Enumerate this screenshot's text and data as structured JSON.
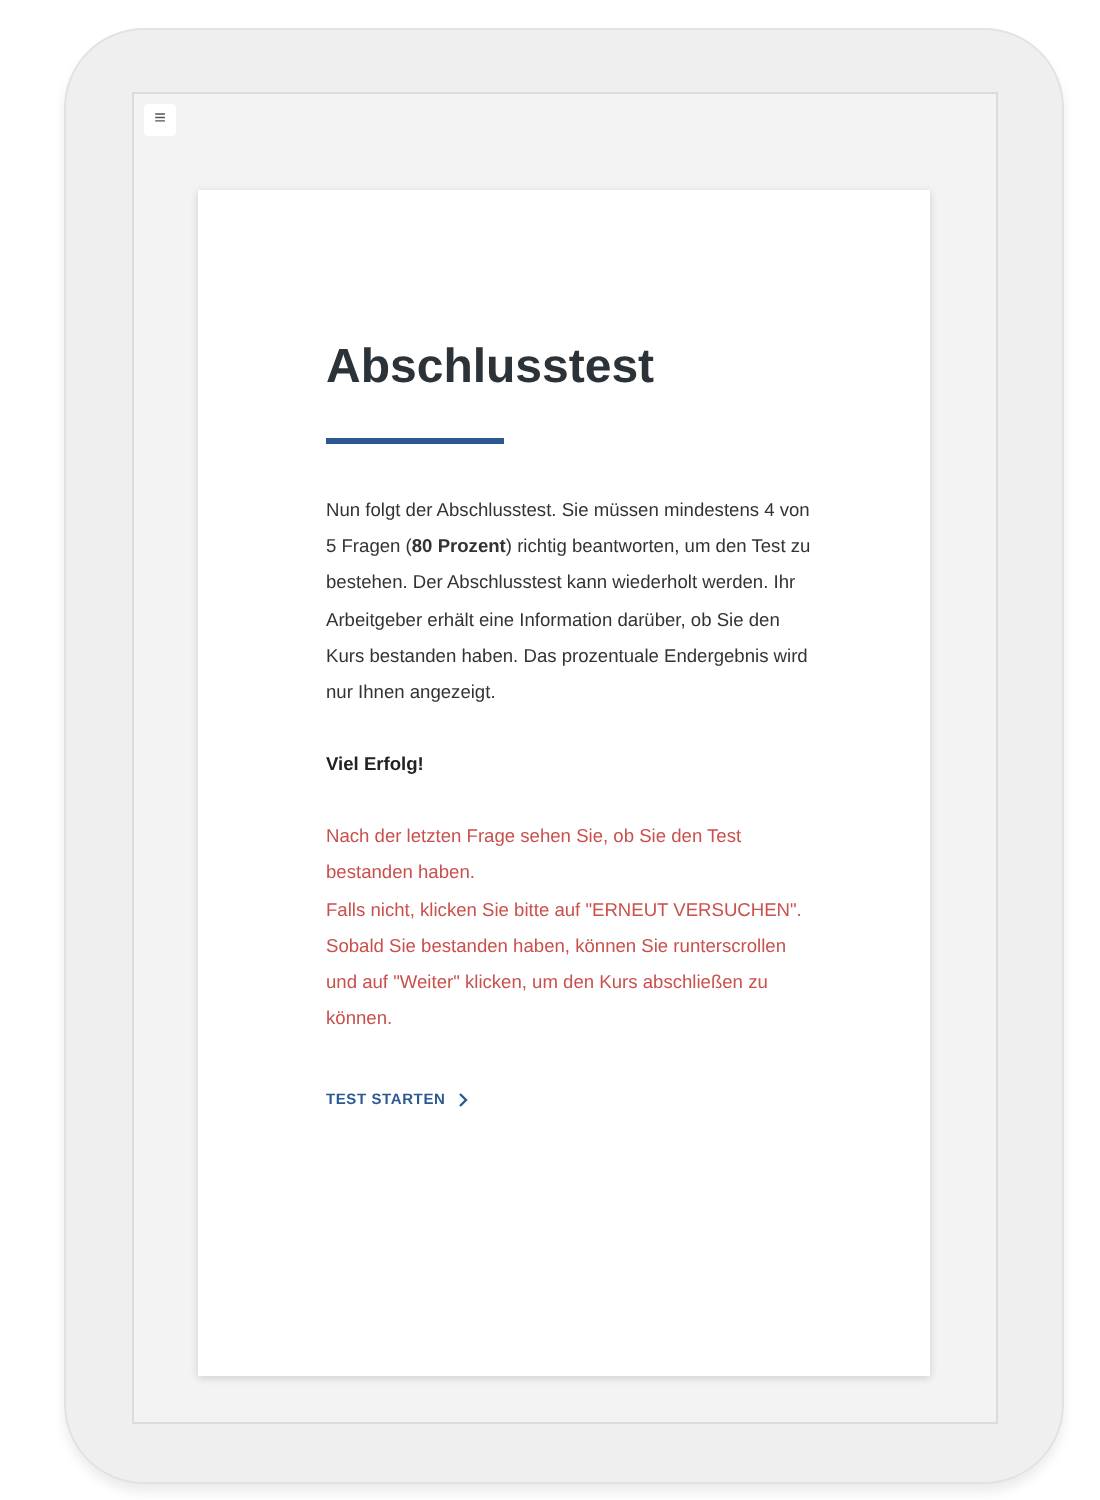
{
  "menu_button": "≡",
  "title": "Abschlusstest",
  "intro": "Nun folgt der Abschlusstest. Sie müssen mindestens 4 von 5 Fragen (**80 Prozent**) richtig beantworten, um den Test zu bestehen. Der Abschlusstest kann wiederholt werden. Ihr Arbeitgeber erhält eine Information darüber, ob Sie den Kurs bestanden haben. Das prozentuale Endergebnis wird nur Ihnen angezeigt.",
  "closing": "Viel Erfolg!",
  "notes": [
    "Nach der letzten Frage sehen Sie, ob Sie den Test bestanden haben.",
    "Falls nicht, klicken Sie bitte auf \"ERNEUT VERSUCHEN\".",
    "Sobald Sie bestanden haben, können Sie runterscrollen und auf \"Weiter\" klicken, um den Kurs abschließen zu können."
  ],
  "start_button": "TEST STARTEN"
}
